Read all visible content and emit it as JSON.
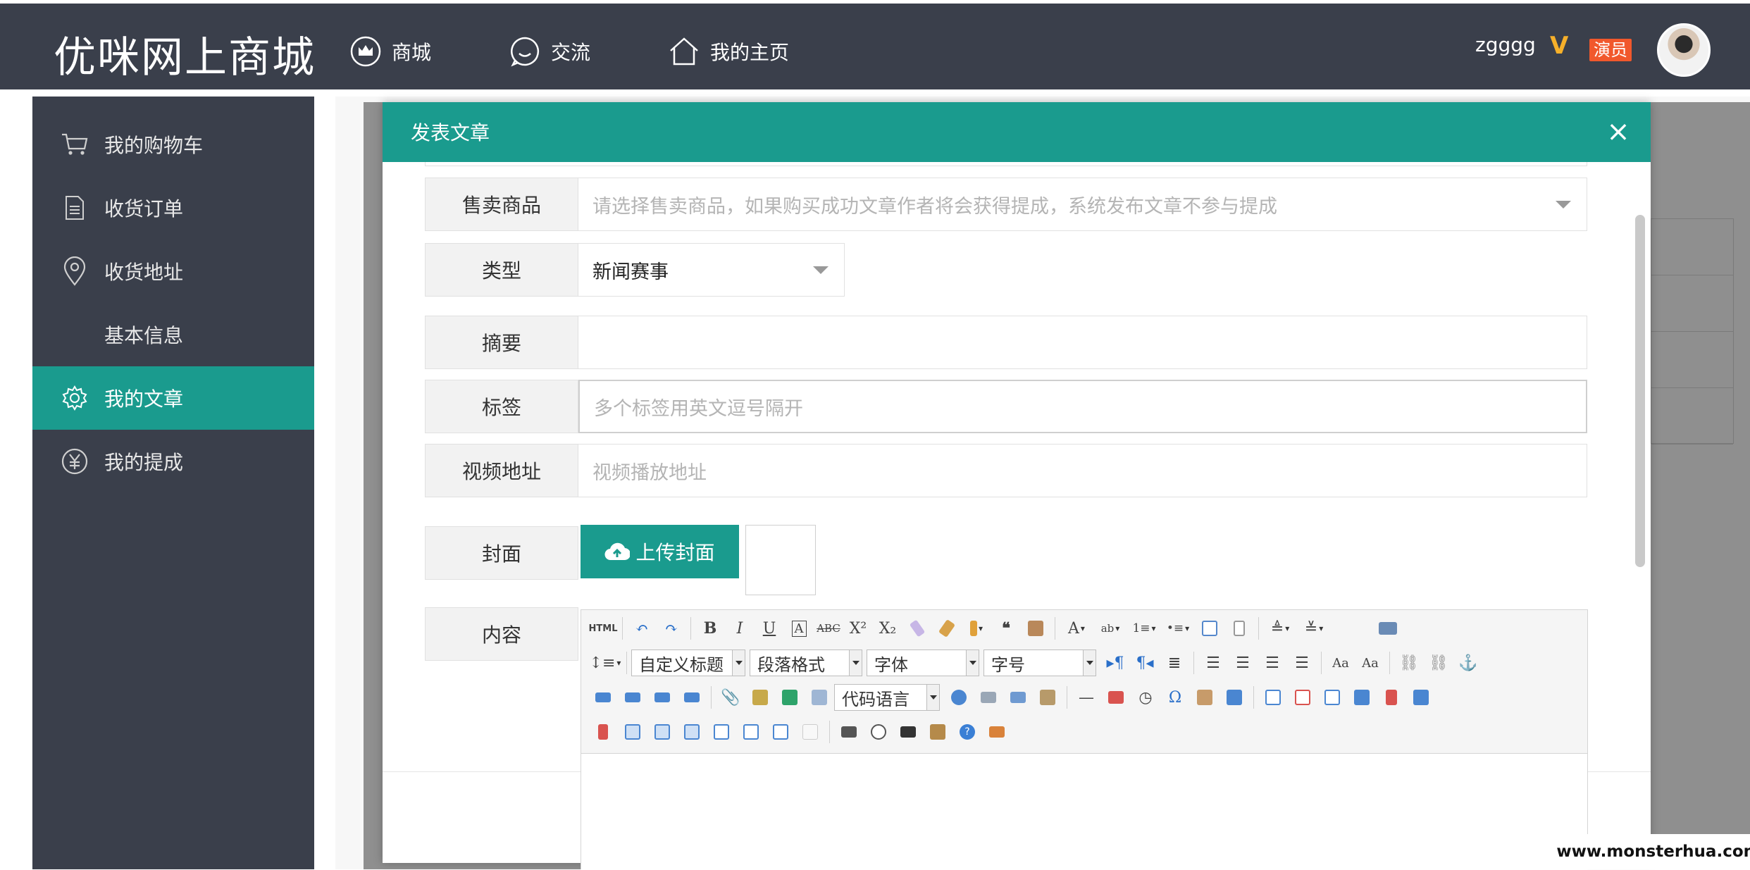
{
  "header": {
    "logo": "优咪网上商城",
    "nav": [
      {
        "label": "商城",
        "icon": "crown-icon"
      },
      {
        "label": "交流",
        "icon": "chat-icon"
      },
      {
        "label": "我的主页",
        "icon": "home-icon"
      }
    ],
    "user": {
      "name": "zgggg",
      "vip_mark": "V",
      "badge": "演员"
    }
  },
  "sidebar": {
    "items": [
      {
        "label": "我的购物车",
        "icon": "cart-icon",
        "active": false
      },
      {
        "label": "收货订单",
        "icon": "document-icon",
        "active": false
      },
      {
        "label": "收货地址",
        "icon": "location-pin-icon",
        "active": false
      },
      {
        "label": "基本信息",
        "icon": "",
        "active": false
      },
      {
        "label": "我的文章",
        "icon": "gear-icon",
        "active": true
      },
      {
        "label": "我的提成",
        "icon": "yuan-icon",
        "active": false
      }
    ]
  },
  "modal": {
    "title": "发表文章",
    "close": "×",
    "fields": {
      "goods": {
        "label": "售卖商品",
        "placeholder": "请选择售卖商品，如果购买成功文章作者将会获得提成，系统发布文章不参与提成"
      },
      "type": {
        "label": "类型",
        "value": "新闻赛事"
      },
      "summary": {
        "label": "摘要",
        "value": ""
      },
      "tags": {
        "label": "标签",
        "placeholder": "多个标签用英文逗号隔开"
      },
      "video": {
        "label": "视频地址",
        "placeholder": "视频播放地址"
      },
      "cover": {
        "label": "封面",
        "button": "上传封面"
      },
      "content": {
        "label": "内容"
      }
    },
    "editor": {
      "combos": {
        "custom_title": "自定义标题",
        "paragraph": "段落格式",
        "font": "字体",
        "size": "字号",
        "code": "代码语言"
      }
    }
  },
  "watermark": "www.monsterhua.com"
}
